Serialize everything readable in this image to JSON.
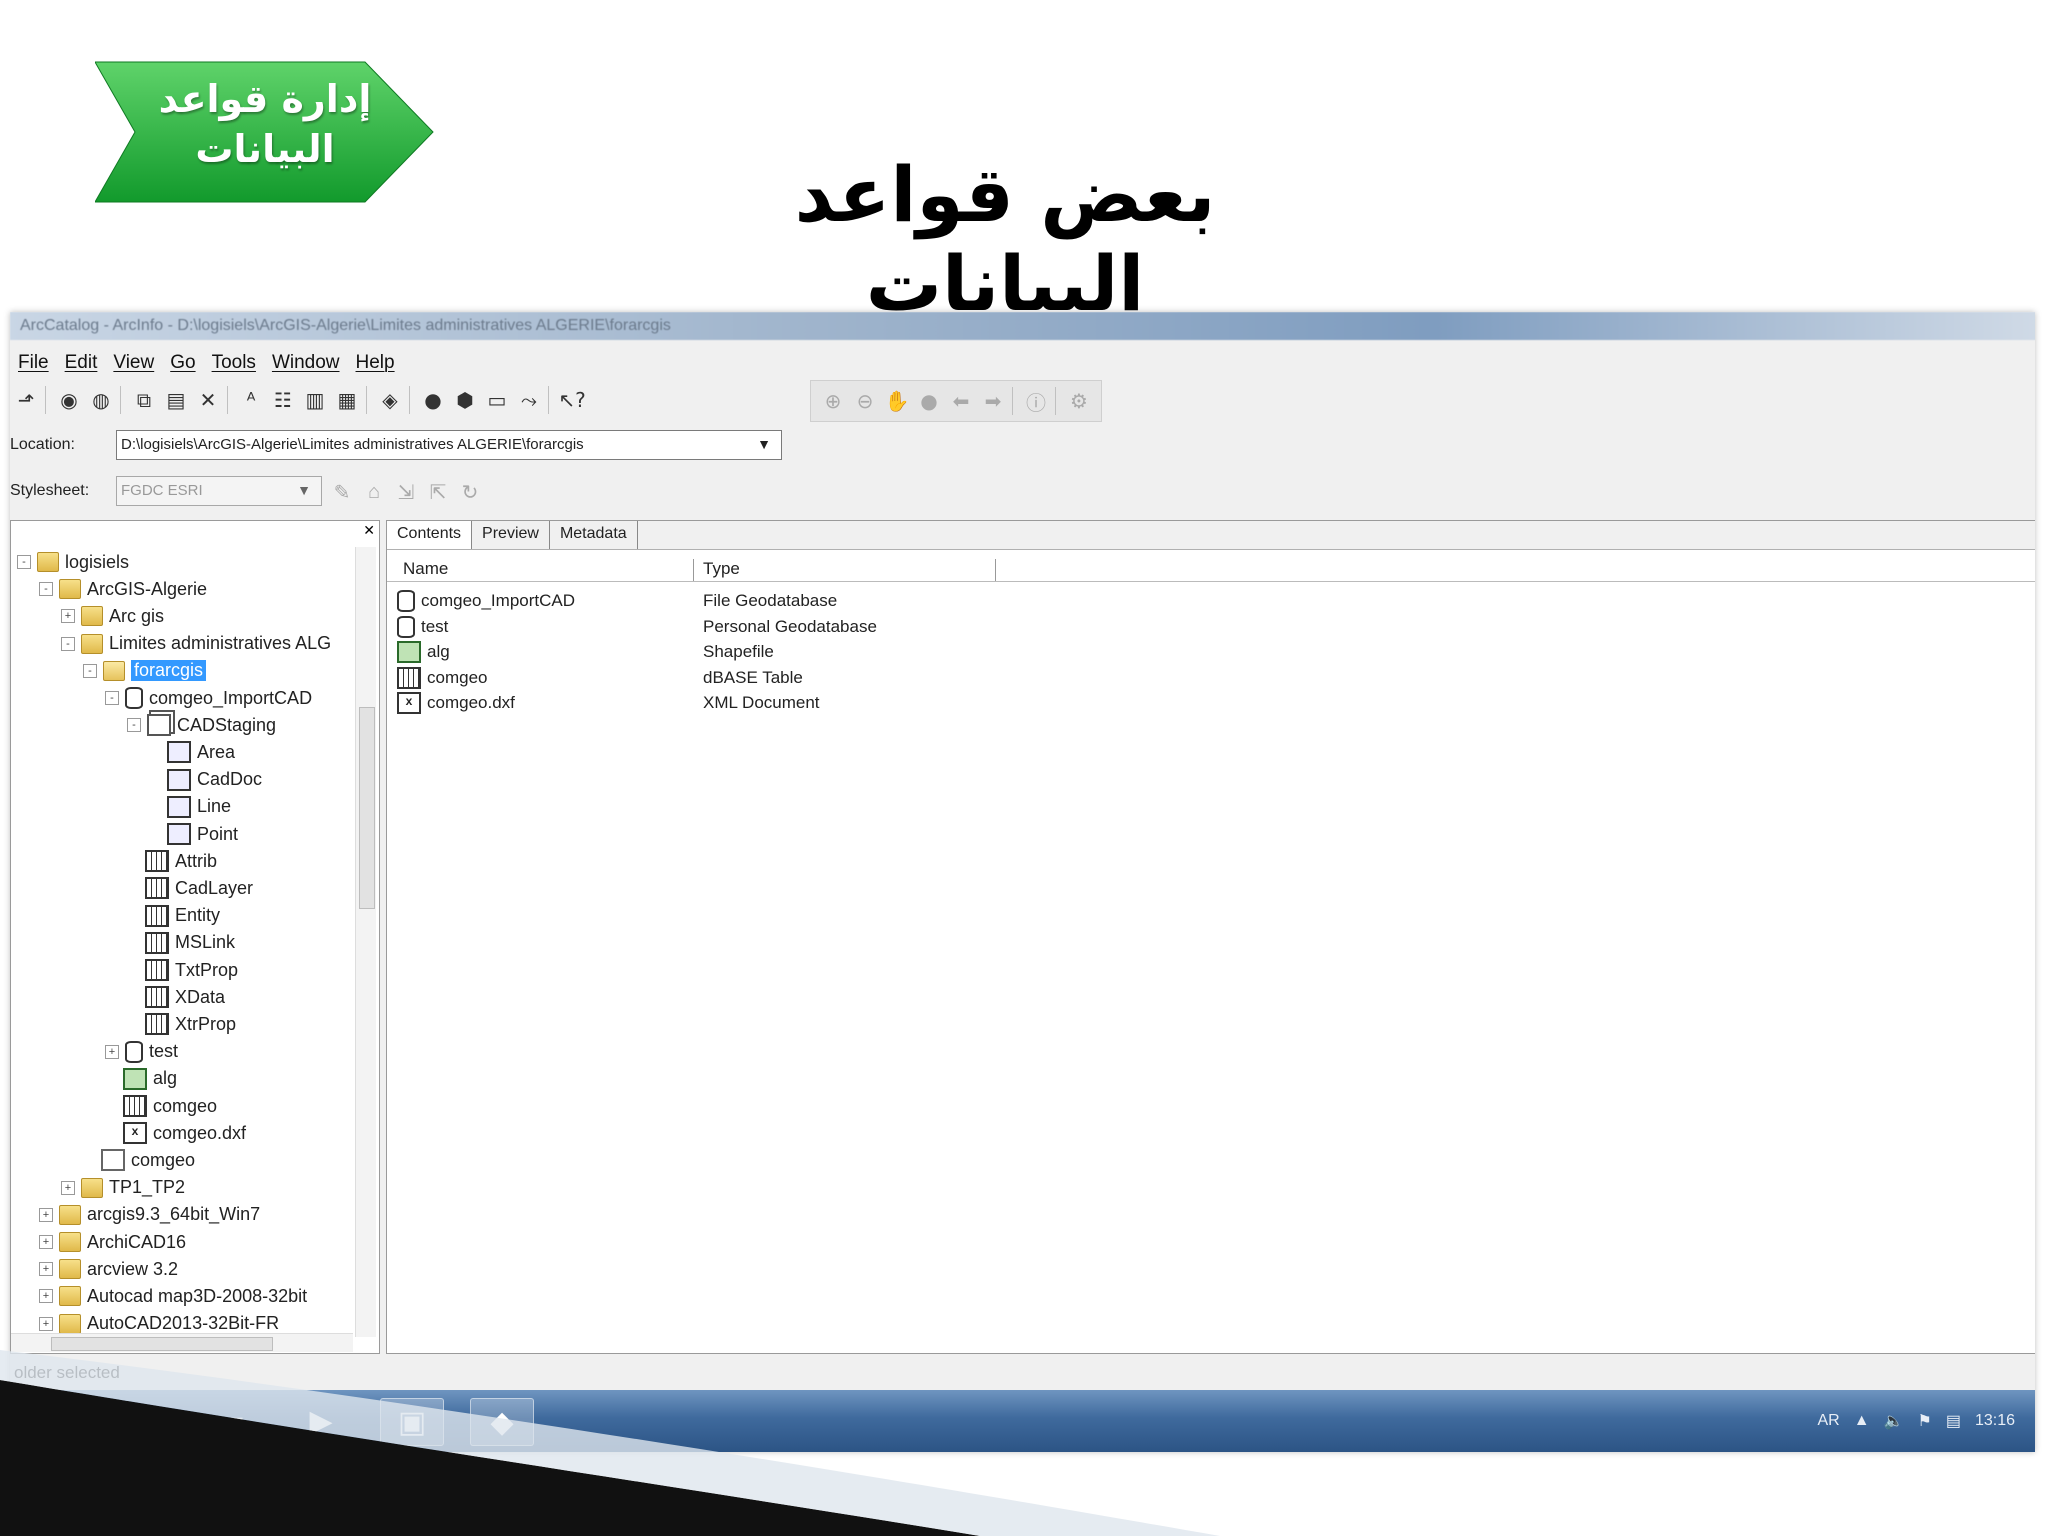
{
  "slide": {
    "badge_text": "إدارة قواعد البيانات",
    "title": "بعض قواعد البيانات"
  },
  "window": {
    "title": "ArcCatalog - ArcInfo - D:\\logisiels\\ArcGIS-Algerie\\Limites administratives ALGERIE\\forarcgis",
    "menu": [
      "File",
      "Edit",
      "View",
      "Go",
      "Tools",
      "Window",
      "Help"
    ],
    "location_label": "Location:",
    "location_value": "D:\\logisiels\\ArcGIS-Algerie\\Limites administratives ALGERIE\\forarcgis",
    "stylesheet_label": "Stylesheet:",
    "stylesheet_value": "FGDC ESRI"
  },
  "tree": [
    {
      "label": "logisiels",
      "level": 0,
      "icon": "folder-icon",
      "expander": "-"
    },
    {
      "label": "ArcGIS-Algerie",
      "level": 1,
      "icon": "folder-icon",
      "expander": "-"
    },
    {
      "label": "Arc gis",
      "level": 2,
      "icon": "folder-icon",
      "expander": "+"
    },
    {
      "label": "Limites administratives ALG",
      "level": 2,
      "icon": "folder-icon",
      "expander": "-"
    },
    {
      "label": "forarcgis",
      "level": 3,
      "icon": "open-folder-icon",
      "expander": "-",
      "selected": true
    },
    {
      "label": "comgeo_ImportCAD",
      "level": 4,
      "icon": "geodatabase-icon",
      "expander": "-"
    },
    {
      "label": "CADStaging",
      "level": 5,
      "icon": "feature-dataset-icon",
      "expander": "-"
    },
    {
      "label": "Area",
      "level": 6,
      "icon": "feature-class-icon",
      "expander": ""
    },
    {
      "label": "CadDoc",
      "level": 6,
      "icon": "feature-class-icon",
      "expander": ""
    },
    {
      "label": "Line",
      "level": 6,
      "icon": "feature-class-icon",
      "expander": ""
    },
    {
      "label": "Point",
      "level": 6,
      "icon": "feature-class-icon",
      "expander": ""
    },
    {
      "label": "Attrib",
      "level": 5,
      "icon": "table-icon",
      "expander": ""
    },
    {
      "label": "CadLayer",
      "level": 5,
      "icon": "table-icon",
      "expander": ""
    },
    {
      "label": "Entity",
      "level": 5,
      "icon": "table-icon",
      "expander": ""
    },
    {
      "label": "MSLink",
      "level": 5,
      "icon": "table-icon",
      "expander": ""
    },
    {
      "label": "TxtProp",
      "level": 5,
      "icon": "table-icon",
      "expander": ""
    },
    {
      "label": "XData",
      "level": 5,
      "icon": "table-icon",
      "expander": ""
    },
    {
      "label": "XtrProp",
      "level": 5,
      "icon": "table-icon",
      "expander": ""
    },
    {
      "label": "test",
      "level": 4,
      "icon": "geodatabase-icon",
      "expander": "+"
    },
    {
      "label": "alg",
      "level": 4,
      "icon": "shapefile-icon",
      "expander": ""
    },
    {
      "label": "comgeo",
      "level": 4,
      "icon": "table-icon",
      "expander": ""
    },
    {
      "label": "comgeo.dxf",
      "level": 4,
      "icon": "xml-icon",
      "expander": ""
    },
    {
      "label": "comgeo",
      "level": 3,
      "icon": "document-icon",
      "expander": ""
    },
    {
      "label": "TP1_TP2",
      "level": 2,
      "icon": "folder-icon",
      "expander": "+"
    },
    {
      "label": "arcgis9.3_64bit_Win7",
      "level": 1,
      "icon": "folder-icon",
      "expander": "+"
    },
    {
      "label": "ArchiCAD16",
      "level": 1,
      "icon": "folder-icon",
      "expander": "+"
    },
    {
      "label": "arcview 3.2",
      "level": 1,
      "icon": "folder-icon",
      "expander": "+"
    },
    {
      "label": "Autocad map3D-2008-32bit",
      "level": 1,
      "icon": "folder-icon",
      "expander": "+"
    },
    {
      "label": "AutoCAD2013-32Bit-FR",
      "level": 1,
      "icon": "folder-icon",
      "expander": "+"
    }
  ],
  "tabs": [
    "Contents",
    "Preview",
    "Metadata"
  ],
  "columns": {
    "name": "Name",
    "type": "Type"
  },
  "contents": [
    {
      "name": "comgeo_ImportCAD",
      "type": "File Geodatabase",
      "icon": "geodatabase-icon"
    },
    {
      "name": "test",
      "type": "Personal Geodatabase",
      "icon": "geodatabase-icon"
    },
    {
      "name": "alg",
      "type": "Shapefile",
      "icon": "shapefile-icon"
    },
    {
      "name": "comgeo",
      "type": "dBASE Table",
      "icon": "table-icon"
    },
    {
      "name": "comgeo.dxf",
      "type": "XML Document",
      "icon": "xml-icon"
    }
  ],
  "status": "older selected",
  "taskbar": {
    "lang": "AR",
    "time": "13:16"
  }
}
